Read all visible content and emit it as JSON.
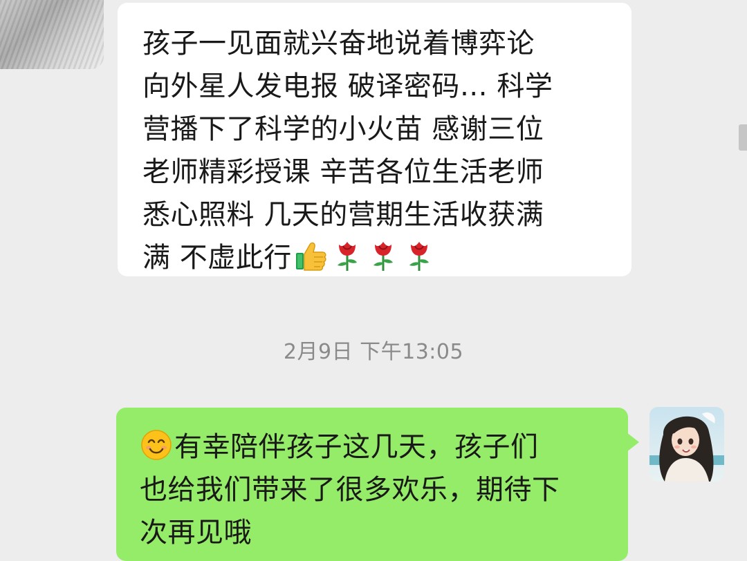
{
  "received_message": {
    "lines": [
      "孩子一见面就兴奋地说着博弈论",
      "向外星人发电报 破译密码… 科学",
      "营播下了科学的小火苗 感谢三位",
      "老师精彩授课 辛苦各位生活老师",
      "悉心照料 几天的营期生活收获满",
      "满 不虚此行"
    ],
    "trailing_emojis": [
      "thumbs-up-emoji",
      "rose-emoji",
      "rose-emoji",
      "rose-emoji"
    ]
  },
  "timestamp": "2月9日 下午13:05",
  "sent_message": {
    "leading_emoji": "smiling-face-emoji",
    "lines": [
      "有幸陪伴孩子这几天，孩子们",
      "也给我们带来了很多欢乐，期待下",
      "次再见哦"
    ]
  },
  "colors": {
    "background": "#ededed",
    "received_bubble": "#ffffff",
    "sent_bubble": "#95ec69",
    "timestamp_text": "#8a8a8a",
    "message_text": "#191919"
  }
}
